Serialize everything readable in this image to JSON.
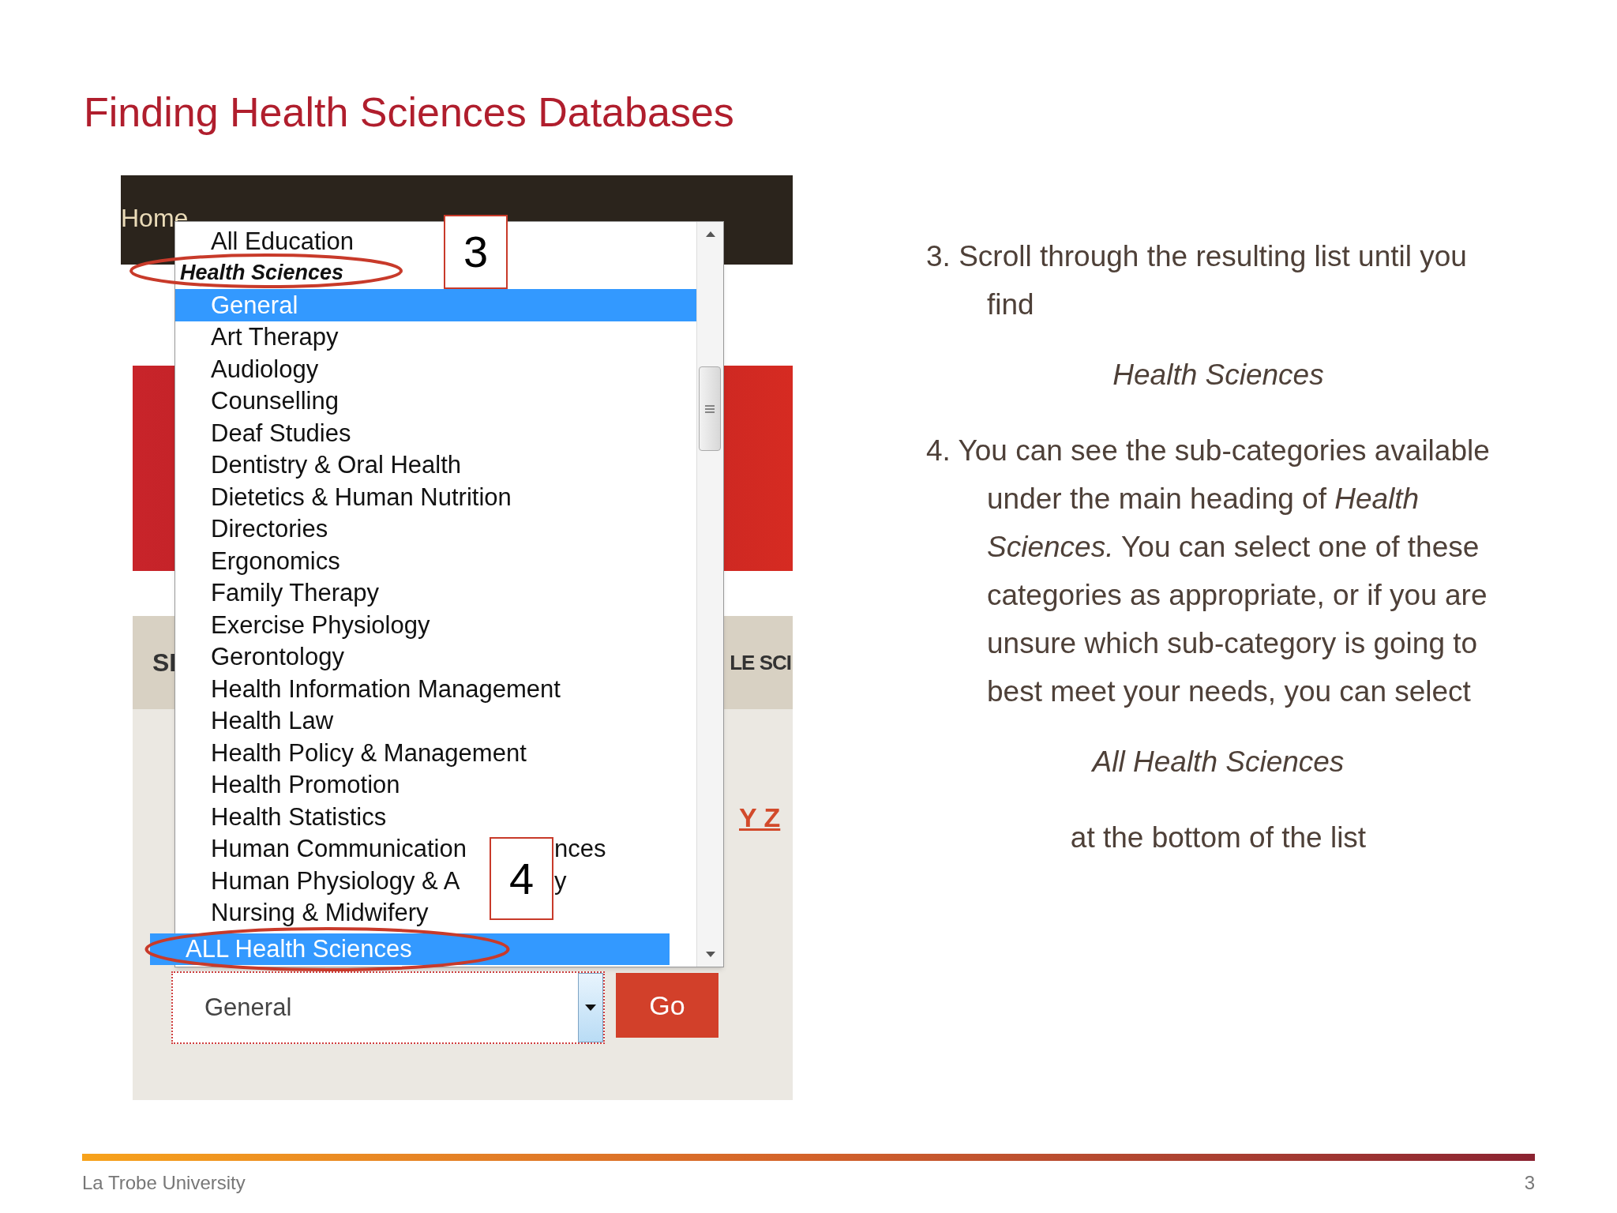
{
  "slide": {
    "title": "Finding Health Sciences Databases",
    "footer": {
      "organization": "La Trobe University",
      "page_number": "3"
    }
  },
  "screenshot": {
    "breadcrumb": "Home",
    "banner_left": "SI",
    "banner_right": "LE SCI",
    "az_letters": "Y Z",
    "select": {
      "value": "General"
    },
    "go_button": "Go",
    "dropdown": {
      "items": [
        {
          "kind": "option",
          "label": "All Education",
          "selected": false
        },
        {
          "kind": "group",
          "label": "Health Sciences",
          "selected": false
        },
        {
          "kind": "option",
          "label": "General",
          "selected": true
        },
        {
          "kind": "option",
          "label": "Art Therapy",
          "selected": false
        },
        {
          "kind": "option",
          "label": "Audiology",
          "selected": false
        },
        {
          "kind": "option",
          "label": "Counselling",
          "selected": false
        },
        {
          "kind": "option",
          "label": "Deaf Studies",
          "selected": false
        },
        {
          "kind": "option",
          "label": "Dentistry & Oral Health",
          "selected": false
        },
        {
          "kind": "option",
          "label": "Dietetics & Human Nutrition",
          "selected": false
        },
        {
          "kind": "option",
          "label": "Directories",
          "selected": false
        },
        {
          "kind": "option",
          "label": "Ergonomics",
          "selected": false
        },
        {
          "kind": "option",
          "label": "Family Therapy",
          "selected": false
        },
        {
          "kind": "option",
          "label": "Exercise Physiology",
          "selected": false
        },
        {
          "kind": "option",
          "label": "Gerontology",
          "selected": false
        },
        {
          "kind": "option",
          "label": "Health Information Management",
          "selected": false
        },
        {
          "kind": "option",
          "label": "Health Law",
          "selected": false
        },
        {
          "kind": "option",
          "label": "Health Policy & Management",
          "selected": false
        },
        {
          "kind": "option",
          "label": "Health Promotion",
          "selected": false
        },
        {
          "kind": "option",
          "label": "Health Statistics",
          "selected": false
        },
        {
          "kind": "option",
          "label": "Human Communication",
          "label_end": "nces",
          "selected": false
        },
        {
          "kind": "option",
          "label": "Human Physiology & A",
          "label_end": "y",
          "selected": false
        },
        {
          "kind": "option",
          "label": "Nursing & Midwifery",
          "selected": false
        }
      ],
      "pinned_item": {
        "label": "ALL Health Sciences",
        "selected": true
      }
    },
    "callouts": [
      {
        "label": "3"
      },
      {
        "label": "4"
      }
    ]
  },
  "instructions": [
    {
      "kind": "step",
      "text": "3. Scroll through the resulting list until you find"
    },
    {
      "kind": "emphasis",
      "text": "Health Sciences"
    },
    {
      "kind": "step",
      "text": "4. You can see the sub-categories available under the main heading of *Health Sciences.* You can select one of these categories as appropriate, or if you are unsure which sub-category is going to best meet your needs, you can select"
    },
    {
      "kind": "emphasis",
      "text": "All Health Sciences"
    },
    {
      "kind": "note",
      "text": "at the bottom of the list"
    }
  ]
}
